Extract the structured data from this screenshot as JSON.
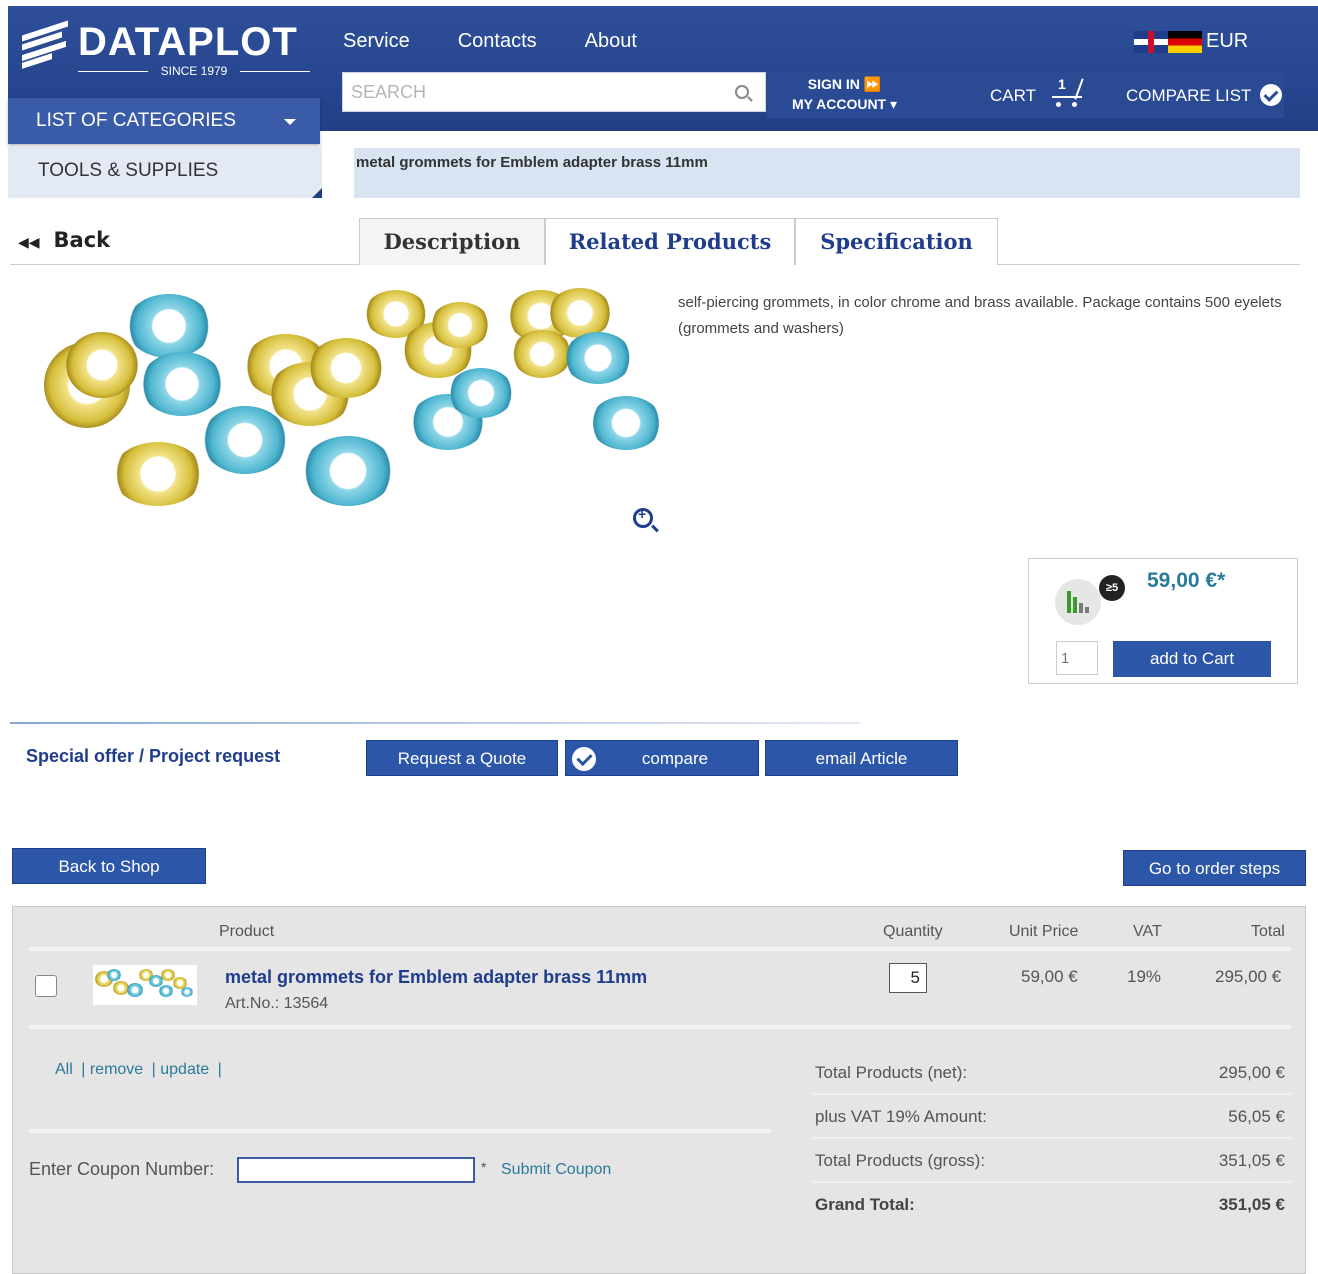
{
  "brand": {
    "name": "DATAPLOT",
    "since": "SINCE 1979"
  },
  "topnav": [
    "Service",
    "Contacts",
    "About"
  ],
  "currency": "EUR",
  "search": {
    "placeholder": "SEARCH"
  },
  "account": {
    "sign_in": "SIGN IN ⏩",
    "my_account": "MY ACCOUNT ▾"
  },
  "cart": {
    "label": "CART",
    "count": "1"
  },
  "compare_list": "COMPARE LIST",
  "categories": {
    "button": "LIST OF CATEGORIES",
    "item": "TOOLS & SUPPLIES"
  },
  "breadcrumb": "metal grommets for Emblem adapter brass 11mm",
  "nav": {
    "back": "Back"
  },
  "tabs": [
    "Description",
    "Related Products",
    "Specification"
  ],
  "product": {
    "description": "self-piercing grommets, in color chrome and brass available. Package contains 500 eyelets (grommets and washers)",
    "price": "59,00 €*",
    "tier_badge": "≥5",
    "qty_placeholder": "1",
    "add_to_cart": "add to Cart"
  },
  "actions": {
    "special_offer": "Special offer / Project request",
    "request_quote": "Request a Quote",
    "compare": "compare",
    "email_article": "email Article",
    "back_to_shop": "Back to Shop",
    "go_to_order": "Go to order steps"
  },
  "cart_table": {
    "headers": {
      "product": "Product",
      "quantity": "Quantity",
      "unit_price": "Unit Price",
      "vat": "VAT",
      "total": "Total"
    },
    "items": [
      {
        "name": "metal grommets for Emblem adapter brass 11mm",
        "art_no": "Art.No.: 13564",
        "quantity": "5",
        "unit_price": "59,00 €",
        "vat": "19%",
        "total": "295,00 €"
      }
    ],
    "links": {
      "all": "All",
      "remove": "| remove",
      "update": "| update",
      "sep": "|"
    },
    "coupon": {
      "label": "Enter Coupon Number:",
      "star": "*",
      "submit": "Submit Coupon"
    },
    "totals": [
      {
        "label": "Total Products (net):",
        "value": "295,00 €"
      },
      {
        "label": "plus VAT 19% Amount:",
        "value": "56,05 €"
      },
      {
        "label": "Total Products (gross):",
        "value": "351,05 €"
      },
      {
        "label": "Grand Total:",
        "value": "351,05 €"
      }
    ]
  },
  "colors": {
    "header_blue": "#27468f",
    "accent_blue": "#2c56a8",
    "link_teal": "#2a7a9a",
    "price_teal": "#2a7a9a"
  },
  "icons": [
    "search-icon",
    "cart-icon",
    "check-circle-icon",
    "caret-down-icon",
    "zoom-in-icon",
    "tier-price-icon",
    "flag-uk-icon",
    "flag-de-icon"
  ]
}
